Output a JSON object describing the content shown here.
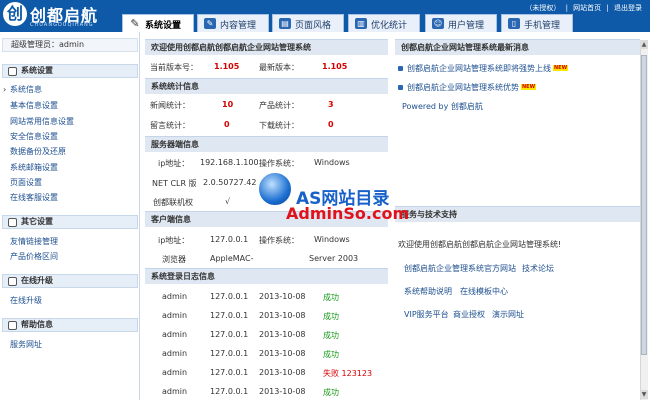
{
  "header": {
    "logo_mark": "创",
    "logo_cn": "创都启航",
    "logo_en": "CHUANGDUQIHANG",
    "top_links": [
      "（未授权）",
      "|",
      "网站首页",
      "|",
      "退出登录"
    ],
    "tabs": [
      {
        "label": "系统设置",
        "icon": "wrench-icon",
        "active": true
      },
      {
        "label": "内容管理",
        "icon": "edit-icon",
        "active": false
      },
      {
        "label": "页面风格",
        "icon": "layout-icon",
        "active": false
      },
      {
        "label": "优化统计",
        "icon": "chart-icon",
        "active": false
      },
      {
        "label": "用户管理",
        "icon": "user-icon",
        "active": false
      },
      {
        "label": "手机管理",
        "icon": "mobile-icon",
        "active": false
      }
    ]
  },
  "sidebar": {
    "admin": "超级管理员：admin",
    "groups": [
      {
        "title": "系统设置",
        "items": [
          "系统信息",
          "基本信息设置",
          "网站常用信息设置",
          "安全信息设置",
          "数据备份及还原",
          "系统邮箱设置",
          "页面设置",
          "在线客服设置"
        ]
      },
      {
        "title": "其它设置",
        "items": [
          "友情链接管理",
          "产品价格区间"
        ]
      },
      {
        "title": "在线升级",
        "items": [
          "在线升级"
        ]
      },
      {
        "title": "帮助信息",
        "items": [
          "服务网址"
        ]
      }
    ]
  },
  "main": {
    "welcome_title": "欢迎使用创都启航创都启航企业网站管理系统",
    "current_version_label": "当前版本号：",
    "current_version": "1.105",
    "latest_version_label": "最新版本：",
    "latest_version": "1.105",
    "stats_title": "系统统计信息",
    "news_label": "新闻统计：",
    "news_count": "10",
    "product_label": "产品统计：",
    "product_count": "3",
    "msg_label": "留言统计：",
    "msg_count": "0",
    "download_label": "下载统计：",
    "download_count": "0",
    "server_title": "服务器端信息",
    "ip_label": "ip地址：",
    "server_ip": "192.168.1.100",
    "os_label": "操作系统：",
    "server_os": "Windows",
    "clr_label": "NET CLR 版",
    "clr_value": "2.0.50727.42",
    "auth_label": "创都联机权",
    "auth_value": "√",
    "client_title": "客户端信息",
    "client_ip_label": "ip地址：",
    "client_ip": "127.0.0.1",
    "client_os_label": "操作系统：",
    "client_os": "Windows",
    "browser_label": "浏览器",
    "browser_value": "AppleMAC-",
    "client_os_ver": "Server 2003",
    "log_title": "系统登录日志信息",
    "logs": [
      {
        "user": "admin",
        "ip": "127.0.0.1",
        "date": "2013-10-08",
        "status": "成功",
        "ok": true
      },
      {
        "user": "admin",
        "ip": "127.0.0.1",
        "date": "2013-10-08",
        "status": "成功",
        "ok": true
      },
      {
        "user": "admin",
        "ip": "127.0.0.1",
        "date": "2013-10-08",
        "status": "成功",
        "ok": true
      },
      {
        "user": "admin",
        "ip": "127.0.0.1",
        "date": "2013-10-08",
        "status": "成功",
        "ok": true
      },
      {
        "user": "admin",
        "ip": "127.0.0.1",
        "date": "2013-10-08",
        "status": "失败 123123",
        "ok": false
      },
      {
        "user": "admin",
        "ip": "127.0.0.1",
        "date": "2013-10-08",
        "status": "成功",
        "ok": true
      }
    ]
  },
  "right": {
    "news_title": "创都启航企业网站管理系统最新消息",
    "news_items": [
      "创都启航企业网站管理系统即将强势上线",
      "创都启航企业网站管理系统优势"
    ],
    "new_badge": "NEW",
    "powered": "Powered by 创都启航",
    "support_title": "服务与技术支持",
    "support_text": "欢迎使用创都启航创都启航企业网站管理系统!",
    "links": [
      [
        "创都启航企业管理系统官方网站",
        "技术论坛"
      ],
      [
        "系统帮助说明",
        "在线模板中心"
      ],
      [
        "VIP服务平台",
        "商业授权",
        "演示网址"
      ]
    ]
  },
  "watermark": {
    "top": "AS网站目录",
    "bottom": "AdminSo.com"
  },
  "colors": {
    "brand": "#0f5aa8",
    "accent_red": "#d40000",
    "success": "#1a9a1a"
  }
}
